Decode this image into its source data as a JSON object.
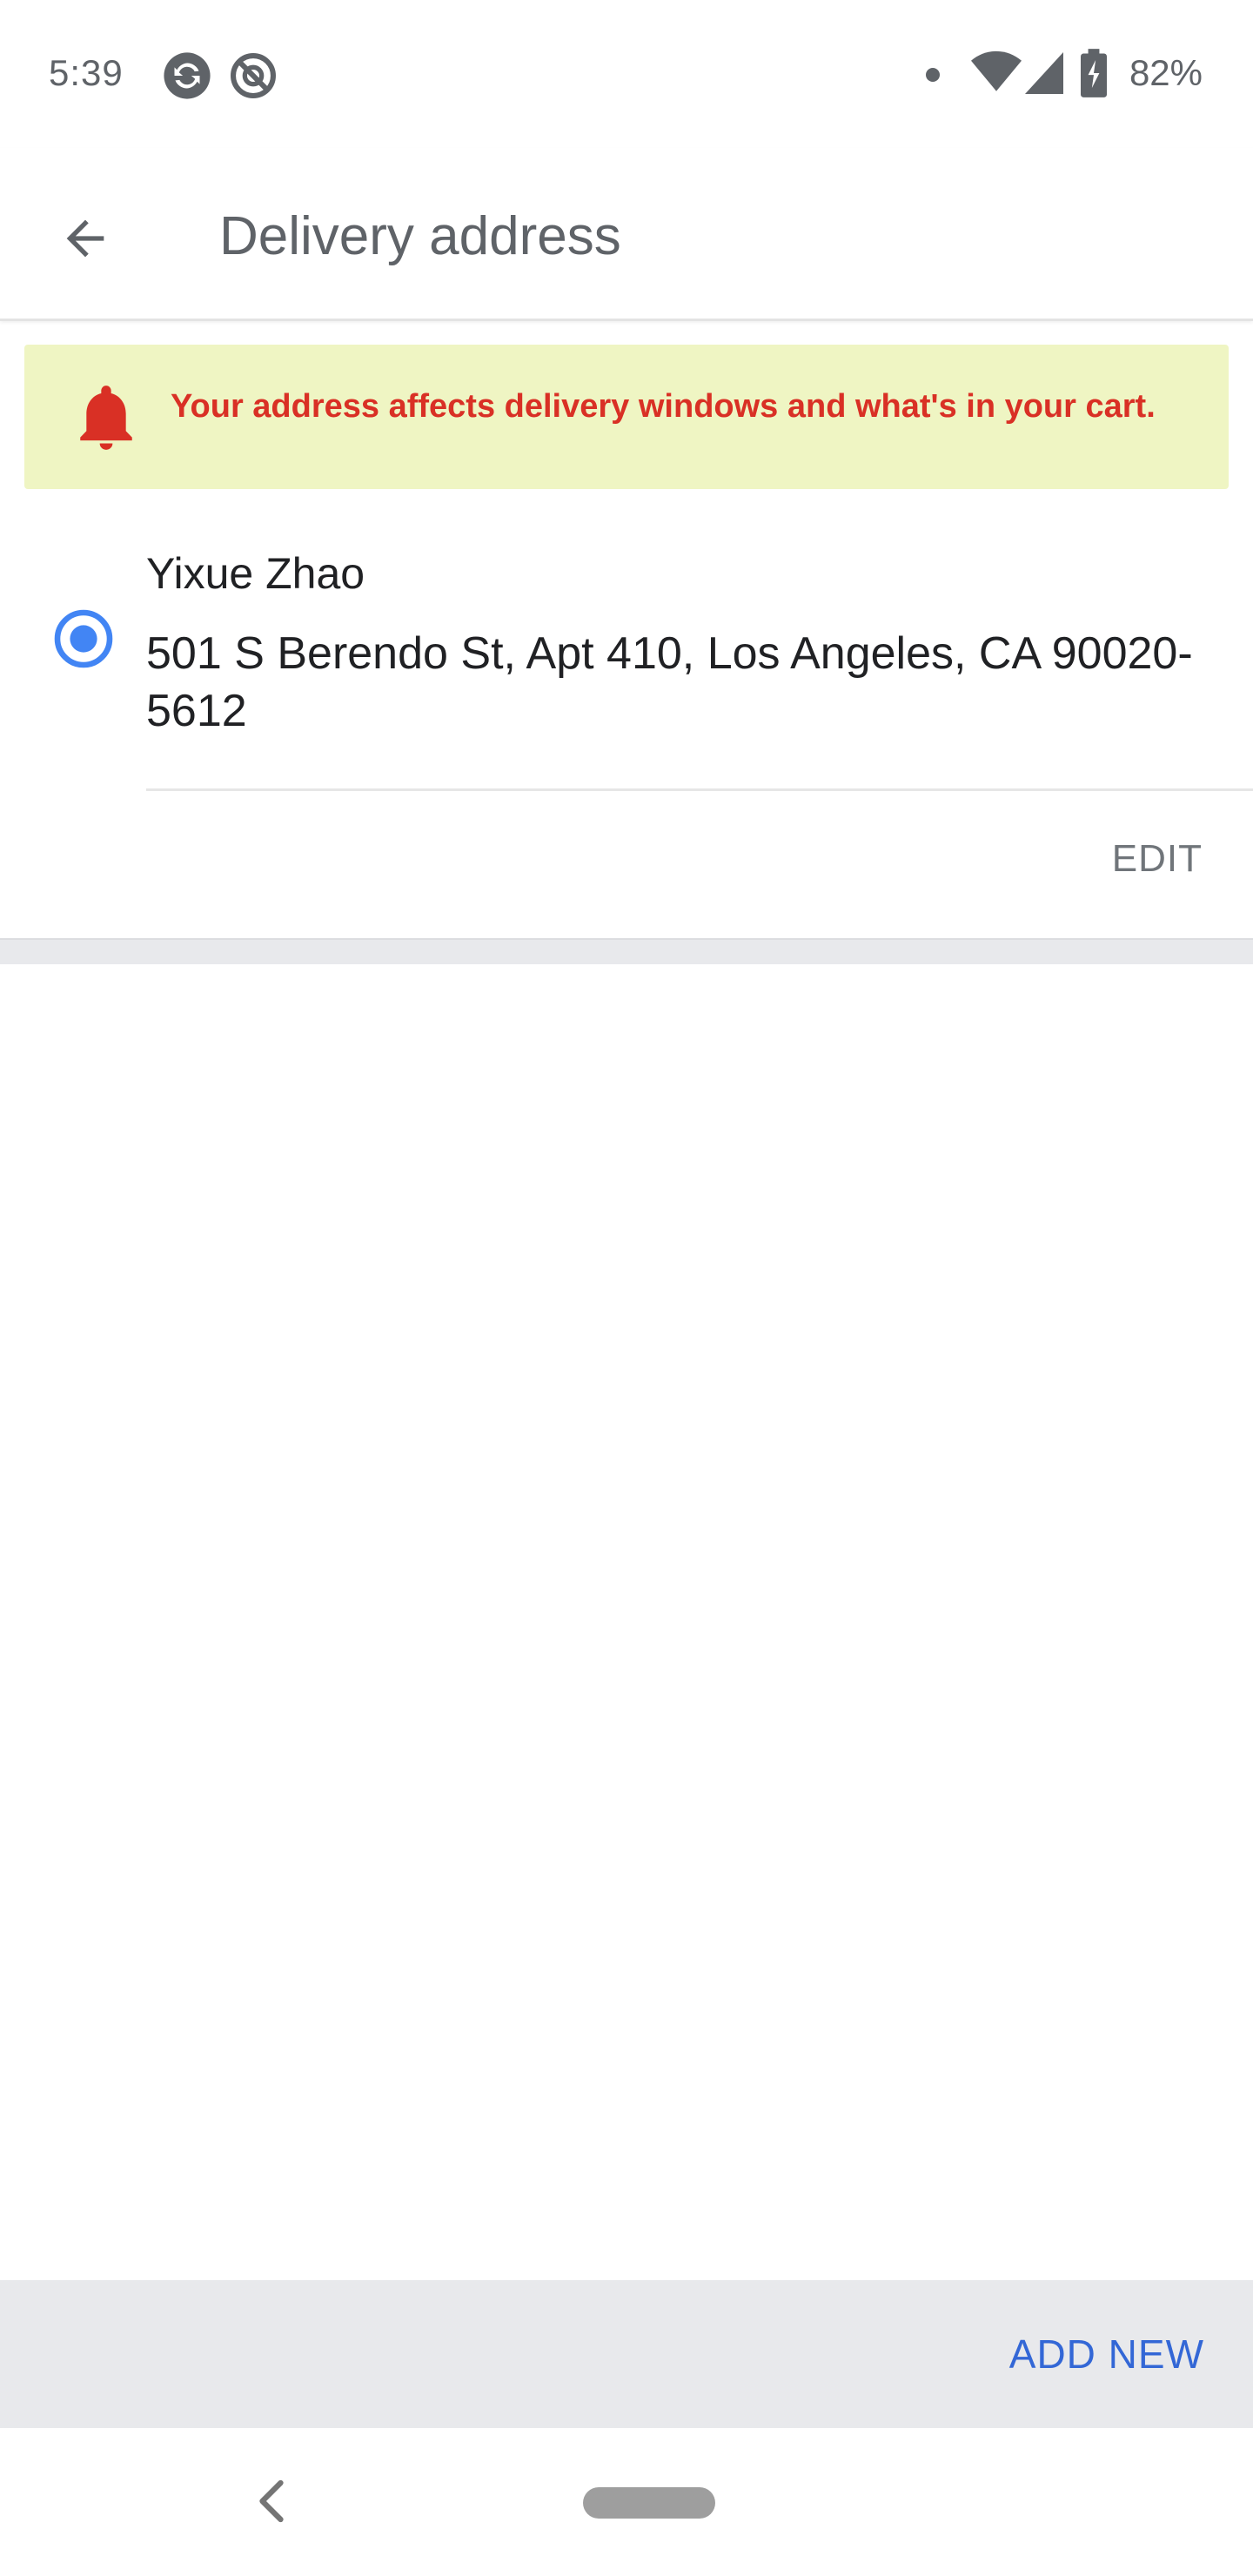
{
  "status_bar": {
    "time": "5:39",
    "battery": "82%",
    "icons": [
      "sync-icon",
      "do-not-disturb-icon",
      "notification-dot-icon",
      "wifi-icon",
      "cell-signal-icon",
      "battery-charging-icon"
    ]
  },
  "app_bar": {
    "title": "Delivery address",
    "back_icon": "arrow-back-icon"
  },
  "banner": {
    "icon": "bell-icon",
    "text": "Your address affects delivery windows and what's in your cart.",
    "background": "#eff5c3",
    "text_color": "#d93025"
  },
  "address": {
    "selected": true,
    "name": "Yixue Zhao",
    "line": "501 S Berendo St, Apt 410, Los Angeles, CA 90020-5612",
    "edit_label": "EDIT"
  },
  "bottom_bar": {
    "add_new_label": "ADD NEW",
    "accent": "#3367d6"
  },
  "nav_bar": {
    "icons": [
      "nav-back-icon",
      "home-pill-icon"
    ]
  }
}
